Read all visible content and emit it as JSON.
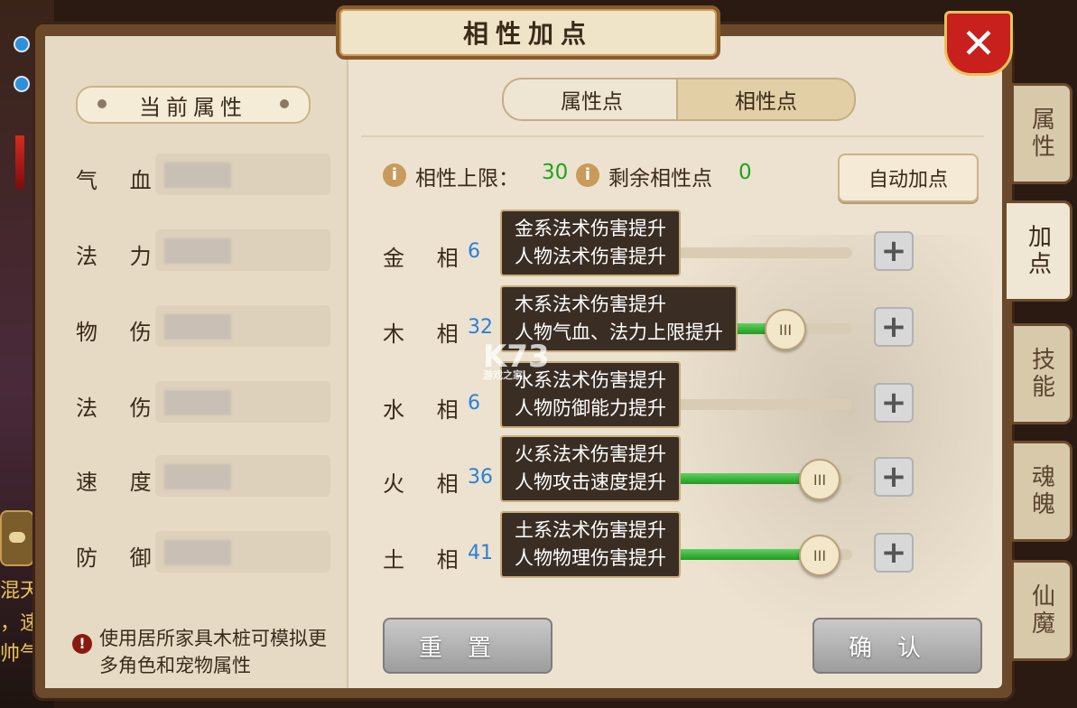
{
  "window": {
    "title": "相性加点",
    "close_label": "✕"
  },
  "left_panel": {
    "header": "当前属性",
    "attributes": [
      {
        "label": "气 血"
      },
      {
        "label": "法 力"
      },
      {
        "label": "物 伤"
      },
      {
        "label": "法 伤"
      },
      {
        "label": "速 度"
      },
      {
        "label": "防 御"
      }
    ],
    "tip_icon": "!",
    "tip": "使用居所家具木桩可模拟更多角色和宠物属性"
  },
  "tabs": [
    {
      "label": "属性点"
    },
    {
      "label": "相性点"
    }
  ],
  "info": {
    "icon": "i",
    "cap_label": "相性上限：",
    "cap_value": "30",
    "remain_label": "剩余相性点",
    "remain_value": "0"
  },
  "auto_button": "自动加点",
  "affinities": [
    {
      "label": "金 相",
      "value": "6",
      "fill": 0.0,
      "tip1": "金系法术伤害提升",
      "tip2": "人物法术伤害提升",
      "plus": "+",
      "knob": "III"
    },
    {
      "label": "木 相",
      "value": "32",
      "fill": 0.8,
      "tip1": "木系法术伤害提升",
      "tip2": "人物气血、法力上限提升",
      "plus": "+",
      "knob": "III"
    },
    {
      "label": "水 相",
      "value": "6",
      "fill": 0.0,
      "tip1": "水系法术伤害提升",
      "tip2": "人物防御能力提升",
      "plus": "+",
      "knob": "III"
    },
    {
      "label": "火 相",
      "value": "36",
      "fill": 0.9,
      "tip1": "火系法术伤害提升",
      "tip2": "人物攻击速度提升",
      "plus": "+",
      "knob": "III"
    },
    {
      "label": "土 相",
      "value": "41",
      "fill": 0.9,
      "tip1": "土系法术伤害提升",
      "tip2": "人物物理伤害提升",
      "plus": "+",
      "knob": "III"
    }
  ],
  "buttons": {
    "reset": "重置",
    "confirm": "确认"
  },
  "side_tabs": [
    {
      "label": "属性"
    },
    {
      "label": "加点"
    },
    {
      "label": "技能"
    },
    {
      "label": "魂魄"
    },
    {
      "label": "仙魔"
    }
  ],
  "background_text": [
    "混天",
    "，速",
    "帅气"
  ],
  "watermark": {
    "main": "K73",
    "sub": "游戏之家"
  },
  "colors": {
    "accent_green": "#1fa31f",
    "value_blue": "#2b7fd8",
    "close_red": "#c8201d"
  }
}
